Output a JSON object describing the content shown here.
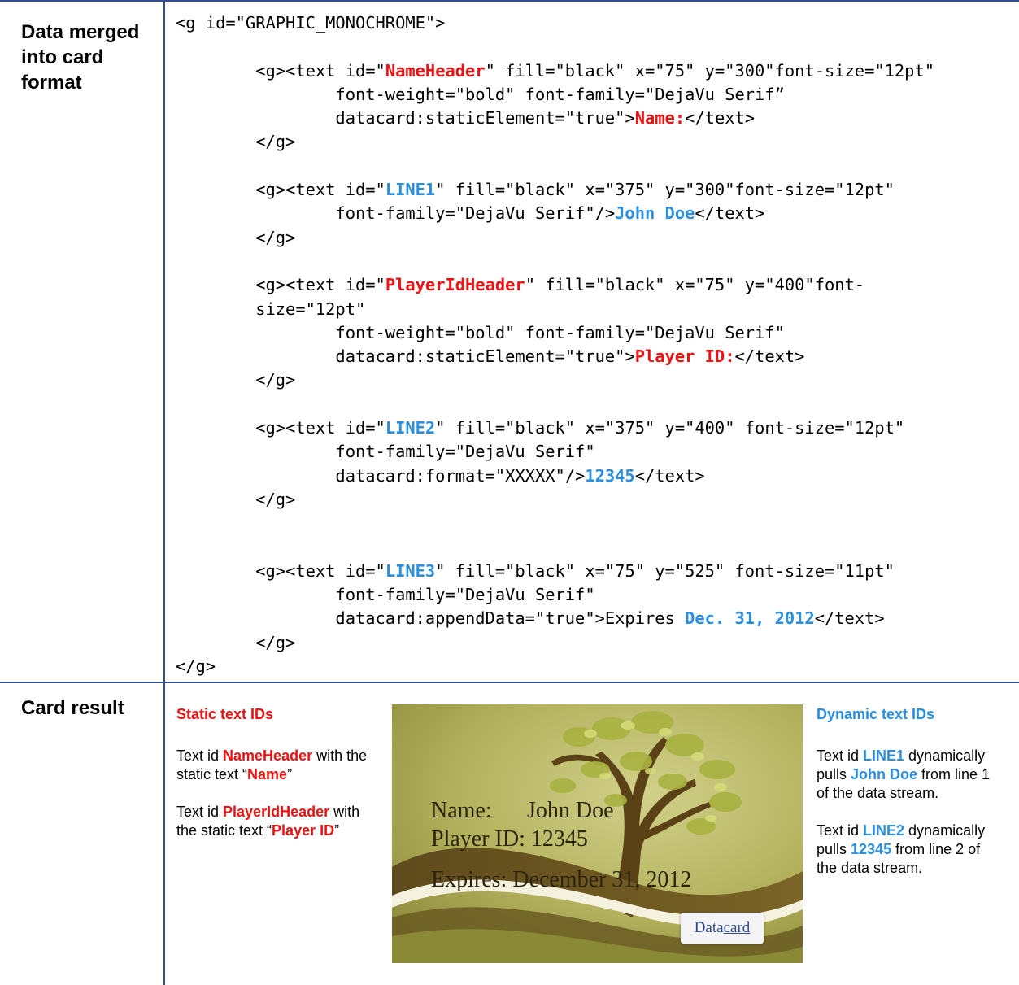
{
  "rows": {
    "row1_label": "Data merged into card format",
    "row2_label": "Card result"
  },
  "code": {
    "l01": "<g id=\"GRAPHIC_MONOCHROME\">",
    "l03a": "        <g><text id=\"",
    "l03b": "NameHeader",
    "l03c": "\" fill=\"black\" x=\"75\" y=\"300\"font-size=\"12pt\"",
    "l04": "                font-weight=\"bold\" font-family=\"DejaVu Serif”",
    "l05a": "                datacard:staticElement=\"true\">",
    "l05b": "Name:",
    "l05c": "</text>",
    "l06": "        </g>",
    "l08a": "        <g><text id=\"",
    "l08b": "LINE1",
    "l08c": "\" fill=\"black\" x=\"375\" y=\"300\"font-size=\"12pt\"",
    "l09a": "                font-family=\"DejaVu Serif\"/>",
    "l09b": "John Doe",
    "l09c": "</text>",
    "l10": "        </g>",
    "l12a": "        <g><text id=\"",
    "l12b": "PlayerIdHeader",
    "l12c": "\" fill=\"black\" x=\"75\" y=\"400\"font-",
    "l13": "        size=\"12pt\"",
    "l14": "                font-weight=\"bold\" font-family=\"DejaVu Serif\"",
    "l15a": "                datacard:staticElement=\"true\">",
    "l15b": "Player ID:",
    "l15c": "</text>",
    "l16": "        </g>",
    "l18a": "        <g><text id=\"",
    "l18b": "LINE2",
    "l18c": "\" fill=\"black\" x=\"375\" y=\"400\" font-size=\"12pt\"",
    "l19": "                font-family=\"DejaVu Serif\"",
    "l20a": "                datacard:format=\"XXXXX\"/>",
    "l20b": "12345",
    "l20c": "</text>",
    "l21": "        </g>",
    "l24a": "        <g><text id=\"",
    "l24b": "LINE3",
    "l24c": "\" fill=\"black\" x=\"75\" y=\"525\" font-size=\"11pt\"",
    "l25": "                font-family=\"DejaVu Serif\"",
    "l26a": "                datacard:appendData=\"true\">Expires ",
    "l26b": "Dec. 31, 2012",
    "l26c": "</text>",
    "l27": "        </g>",
    "l28": "</g>"
  },
  "static_notes": {
    "heading": "Static text IDs",
    "p1_a": "Text id ",
    "p1_b": "NameHeader",
    "p1_c": " with the static text “",
    "p1_d": "Name",
    "p1_e": "”",
    "p2_a": "Text id ",
    "p2_b": "PlayerIdHeader",
    "p2_c": " with the static text “",
    "p2_d": "Player ID",
    "p2_e": "”"
  },
  "dynamic_notes": {
    "heading": "Dynamic text IDs",
    "p1_a": "Text id ",
    "p1_b": "LINE1",
    "p1_c": " dynamically pulls ",
    "p1_d": "John Doe",
    "p1_e": " from line 1 of the data stream.",
    "p2_a": "Text id ",
    "p2_b": "LINE2",
    "p2_c": " dynamically pulls ",
    "p2_d": "12345",
    "p2_e": " from line 2 of the data stream."
  },
  "card": {
    "name_label": "Name:",
    "name_value": "John Doe",
    "player_line": "Player ID: 12345",
    "expires_line": "Expires: December 31, 2012",
    "logo_a": "Data",
    "logo_b": "card"
  },
  "colors": {
    "static_red": "#ee1111",
    "dynamic_blue": "#2b8fe0",
    "rule_blue": "#2f4f8f"
  }
}
